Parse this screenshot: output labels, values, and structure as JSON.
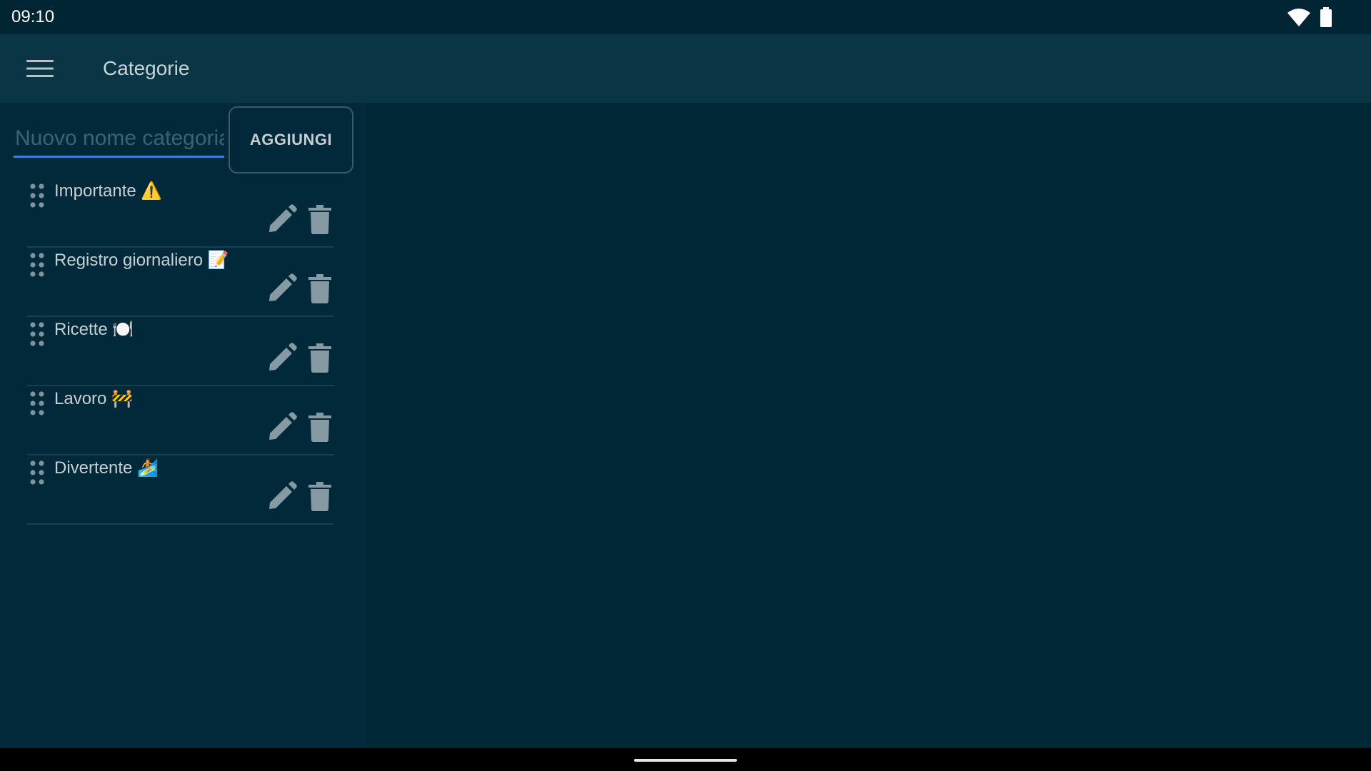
{
  "status_bar": {
    "time": "09:10",
    "icons": [
      "wifi-icon",
      "battery-icon"
    ]
  },
  "app_bar": {
    "menu_icon": "menu-icon",
    "title": "Categorie"
  },
  "new_category": {
    "value": "",
    "placeholder": "Nuovo nome categoria",
    "add_label": "AGGIUNGI"
  },
  "categories": [
    {
      "label": "Importante ⚠️"
    },
    {
      "label": "Registro giornaliero 📝"
    },
    {
      "label": "Ricette 🍽️"
    },
    {
      "label": "Lavoro 🚧"
    },
    {
      "label": "Divertente 🏄"
    }
  ],
  "colors": {
    "background": "#012837",
    "app_bar": "#0a3545",
    "accent": "#2b86d6",
    "icon": "#869aa3",
    "text": "#c5d0d5"
  }
}
